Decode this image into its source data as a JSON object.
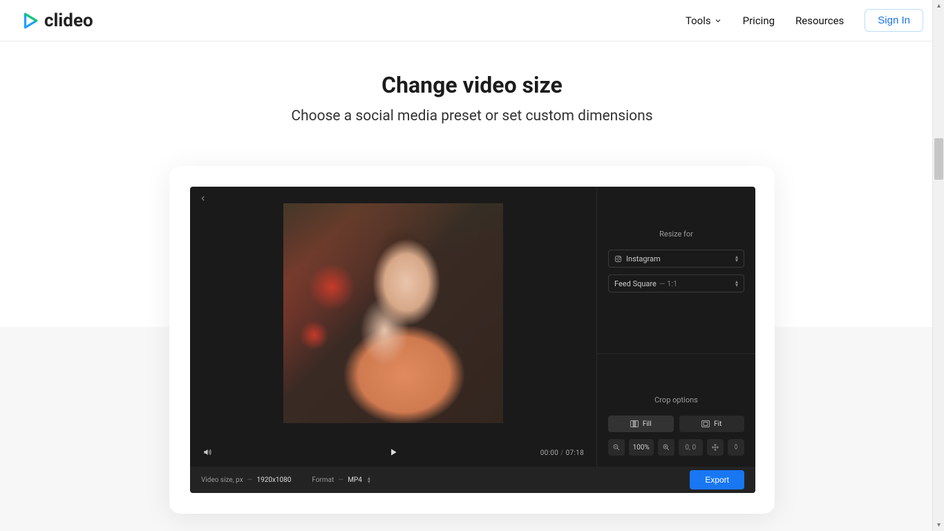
{
  "brand": "clideo",
  "nav": {
    "tools": "Tools",
    "pricing": "Pricing",
    "resources": "Resources",
    "signin": "Sign In"
  },
  "hero": {
    "title": "Change video size",
    "subtitle": "Choose a social media preset or set custom dimensions"
  },
  "editor": {
    "resize_for": "Resize for",
    "platform": "Instagram",
    "preset_name": "Feed Square",
    "preset_ratio": "— 1:1",
    "crop_options": "Crop options",
    "fill": "Fill",
    "fit": "Fit",
    "zoom": "100%",
    "position": "0, 0",
    "time_current": "00:00",
    "time_total": "07:18",
    "video_size_label": "Video size, px",
    "video_size_value": "1920x1080",
    "format_label": "Format",
    "format_value": "MP4",
    "export": "Export"
  }
}
